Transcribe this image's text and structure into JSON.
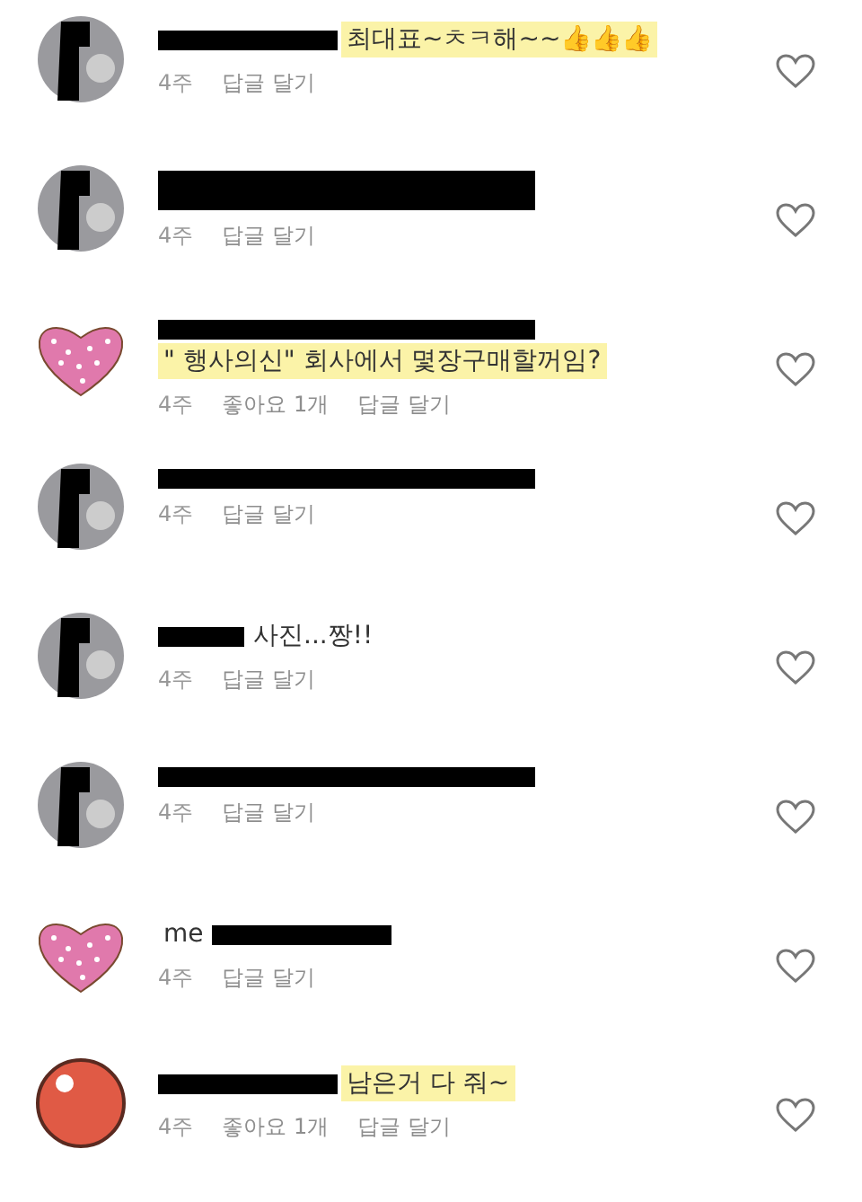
{
  "comments": [
    {
      "kind": "plain",
      "avatar": {
        "kind": "photo"
      },
      "redaction": {
        "kind": "medium"
      },
      "text": "최대표~ㅊㅋ해~~👍👍👍",
      "highlight": true,
      "time": "4주",
      "reply": "답글 달기"
    },
    {
      "kind": "plain",
      "avatar": {
        "kind": "photo"
      },
      "redaction": {
        "kind": "double"
      },
      "time": "4주",
      "reply": "답글 달기"
    },
    {
      "kind": "plain",
      "avatar": {
        "kind": "heart"
      },
      "redaction": {
        "kind": "long"
      },
      "text": "\" 행사의신\" 회사에서 몇장구매할꺼임?",
      "highlight": true,
      "time": "4주",
      "likes": "좋아요 1개",
      "reply": "답글 달기"
    },
    {
      "kind": "plain",
      "avatar": {
        "kind": "photo"
      },
      "redaction": {
        "kind": "long"
      },
      "time": "4주",
      "reply": "답글 달기"
    },
    {
      "kind": "plain",
      "avatar": {
        "kind": "photo"
      },
      "redaction": {
        "kind": "short"
      },
      "text": "사진...짱!!",
      "highlight": false,
      "time": "4주",
      "reply": "답글 달기"
    },
    {
      "kind": "plain",
      "avatar": {
        "kind": "photo"
      },
      "redaction": {
        "kind": "long"
      },
      "time": "4주",
      "reply": "답글 달기"
    },
    {
      "kind": "prefix",
      "avatar": {
        "kind": "heart"
      },
      "redaction": {
        "kind": "medium"
      },
      "text": "me",
      "highlight": false,
      "time": "4주",
      "reply": "답글 달기"
    },
    {
      "kind": "plain",
      "avatar": {
        "kind": "ball"
      },
      "redaction": {
        "kind": "medium"
      },
      "text": "남은거 다 줘~",
      "highlight": true,
      "time": "4주",
      "likes": "좋아요 1개",
      "reply": "답글 달기"
    }
  ]
}
